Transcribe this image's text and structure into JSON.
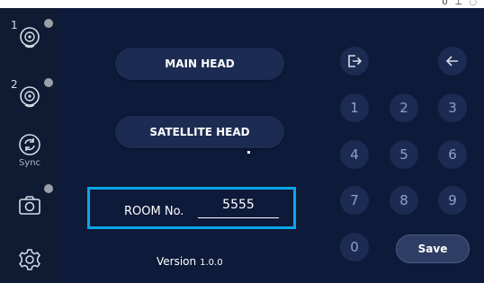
{
  "status_bar": {
    "text": "∪ ⊥ ◌"
  },
  "sidebar": {
    "items": [
      {
        "number": "1",
        "icon": "main-head-icon"
      },
      {
        "number": "2",
        "icon": "satellite-head-icon"
      },
      {
        "label": "Sync",
        "icon": "sync-icon"
      },
      {
        "icon": "camera-icon"
      },
      {
        "icon": "settings-gear-icon"
      }
    ]
  },
  "main": {
    "main_head_label": "MAIN HEAD",
    "satellite_head_label": "SATELLITE HEAD",
    "room": {
      "label": "ROOM No.",
      "value": "5555"
    },
    "version": {
      "label": "Version",
      "number": "1.0.0"
    }
  },
  "keypad": {
    "keys": [
      "1",
      "2",
      "3",
      "4",
      "5",
      "6",
      "7",
      "8",
      "9",
      "0"
    ],
    "save_label": "Save",
    "exit_icon": "exit-icon",
    "back_icon": "backspace-arrow-icon"
  },
  "colors": {
    "background": "#0d1a3a",
    "sidebar": "#0f1b33",
    "button": "#1c2b52",
    "highlight": "#0aa6e8"
  }
}
